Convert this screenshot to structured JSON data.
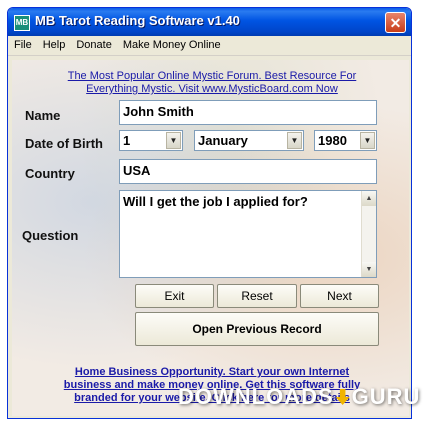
{
  "window": {
    "title": "MB Tarot Reading Software v1.40",
    "close_label": "✕"
  },
  "menu": [
    "File",
    "Help",
    "Donate",
    "Make Money Online"
  ],
  "top_link": {
    "line1": "The Most Popular Online Mystic Forum. Best Resource For",
    "line2": "Everything Mystic. Visit www.MysticBoard.com Now"
  },
  "form": {
    "name_label": "Name",
    "name_value": "John Smith",
    "dob_label": "Date of Birth",
    "day_value": "1",
    "month_value": "January",
    "year_value": "1980",
    "country_label": "Country",
    "country_value": "USA",
    "question_label": "Question",
    "question_value": "Will I get the job I applied for?"
  },
  "buttons": {
    "exit": "Exit",
    "reset": "Reset",
    "next": "Next",
    "open_previous": "Open Previous Record"
  },
  "bottom_link": {
    "line1": "Home Business Opportunity. Start your own Internet",
    "line2": "business and make money online. Get this software fully",
    "line3": "branded for your website. Click here for more details"
  },
  "watermark": {
    "left": "DOWNLOADS",
    "right": "GURU"
  }
}
